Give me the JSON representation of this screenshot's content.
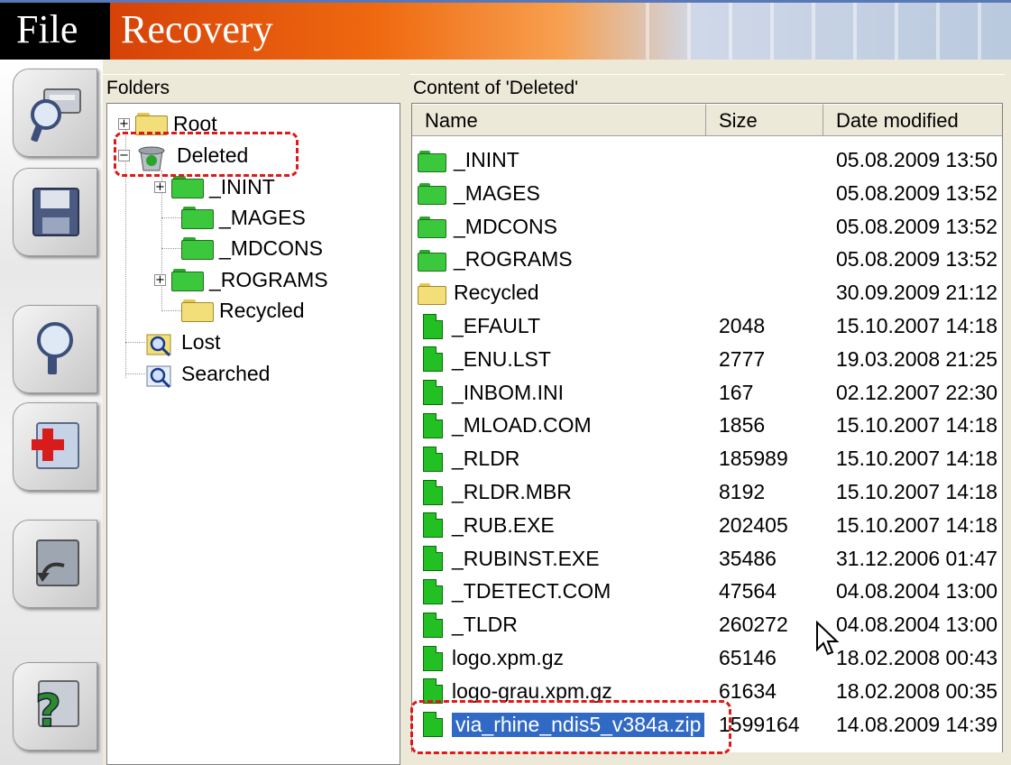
{
  "header": {
    "title_part1": "File",
    "title_part2": "Recovery"
  },
  "sidebar": {
    "tabs": [
      {
        "icon": "drive-magnifier-icon"
      },
      {
        "icon": "floppy-save-icon"
      },
      {
        "icon": "magnifier-icon"
      },
      {
        "icon": "first-aid-folder-icon"
      },
      {
        "icon": "folder-restore-icon"
      },
      {
        "icon": "help-question-icon"
      }
    ]
  },
  "folders_panel": {
    "title": "Folders",
    "tree": [
      {
        "label": "Root",
        "expander": "+",
        "icon": "folder-yellow"
      },
      {
        "label": "Deleted",
        "expander": "−",
        "icon": "recycle-bin"
      },
      {
        "label": "_ININT",
        "expander": "+",
        "icon": "folder-green"
      },
      {
        "label": "_MAGES",
        "expander": "",
        "icon": "folder-green"
      },
      {
        "label": "_MDCONS",
        "expander": "",
        "icon": "folder-green"
      },
      {
        "label": "_ROGRAMS",
        "expander": "+",
        "icon": "folder-green"
      },
      {
        "label": "Recycled",
        "expander": "",
        "icon": "folder-yellow"
      },
      {
        "label": "Lost",
        "expander": "",
        "icon": "folder-search"
      },
      {
        "label": "Searched",
        "expander": "",
        "icon": "folder-search"
      }
    ]
  },
  "content_panel": {
    "title": "Content of 'Deleted'",
    "columns": {
      "name": "Name",
      "size": "Size",
      "date": "Date modified"
    },
    "rows": [
      {
        "name": "_ININT",
        "size": "",
        "date": "05.08.2009 13:50",
        "type": "folder-green"
      },
      {
        "name": "_MAGES",
        "size": "",
        "date": "05.08.2009 13:52",
        "type": "folder-green"
      },
      {
        "name": "_MDCONS",
        "size": "",
        "date": "05.08.2009 13:52",
        "type": "folder-green"
      },
      {
        "name": "_ROGRAMS",
        "size": "",
        "date": "05.08.2009 13:52",
        "type": "folder-green"
      },
      {
        "name": "Recycled",
        "size": "",
        "date": "30.09.2009 21:12",
        "type": "folder-yellow"
      },
      {
        "name": "_EFAULT",
        "size": "2048",
        "date": "15.10.2007 14:18",
        "type": "file"
      },
      {
        "name": "_ENU.LST",
        "size": "2777",
        "date": "19.03.2008 21:25",
        "type": "file"
      },
      {
        "name": "_INBOM.INI",
        "size": "167",
        "date": "02.12.2007 22:30",
        "type": "file"
      },
      {
        "name": "_MLOAD.COM",
        "size": "1856",
        "date": "15.10.2007 14:18",
        "type": "file"
      },
      {
        "name": "_RLDR",
        "size": "185989",
        "date": "15.10.2007 14:18",
        "type": "file"
      },
      {
        "name": "_RLDR.MBR",
        "size": "8192",
        "date": "15.10.2007 14:18",
        "type": "file"
      },
      {
        "name": "_RUB.EXE",
        "size": "202405",
        "date": "15.10.2007 14:18",
        "type": "file"
      },
      {
        "name": "_RUBINST.EXE",
        "size": "35486",
        "date": "31.12.2006 01:47",
        "type": "file"
      },
      {
        "name": "_TDETECT.COM",
        "size": "47564",
        "date": "04.08.2004 13:00",
        "type": "file"
      },
      {
        "name": "_TLDR",
        "size": "260272",
        "date": "04.08.2004 13:00",
        "type": "file"
      },
      {
        "name": "logo.xpm.gz",
        "size": "65146",
        "date": "18.02.2008 00:43",
        "type": "file"
      },
      {
        "name": "logo-grau.xpm.gz",
        "size": "61634",
        "date": "18.02.2008 00:35",
        "type": "file"
      },
      {
        "name": "via_rhine_ndis5_v384a.zip",
        "size": "1599164",
        "date": "14.08.2009 14:39",
        "type": "file",
        "selected": true
      }
    ]
  },
  "colors": {
    "file_green": "#22c022",
    "folder_green": "#3cc83c",
    "folder_yellow": "#f3df7a",
    "selection": "#316ac5",
    "highlight_box": "#e01818"
  }
}
